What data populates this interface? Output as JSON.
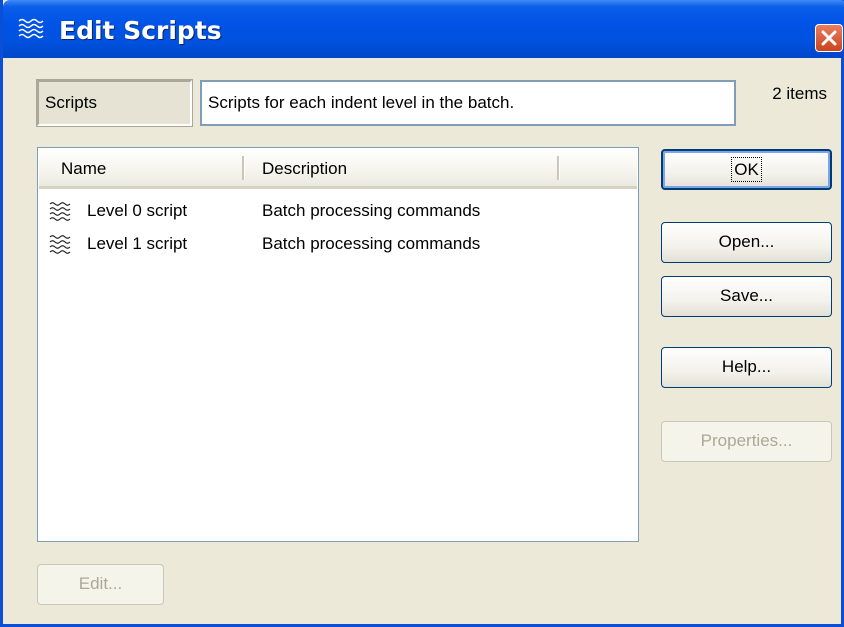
{
  "window": {
    "title": "Edit Scripts",
    "icon": "wavy-lines-icon",
    "close_icon": "close-icon"
  },
  "header": {
    "label": "Scripts",
    "description": "Scripts for each indent level in the batch.",
    "item_count": "2 items"
  },
  "list": {
    "columns": [
      "Name",
      "Description"
    ],
    "rows": [
      {
        "icon": "wavy-lines-icon",
        "name": "Level 0 script",
        "description": "Batch processing commands"
      },
      {
        "icon": "wavy-lines-icon",
        "name": "Level 1 script",
        "description": "Batch processing commands"
      }
    ]
  },
  "buttons": {
    "ok": "OK",
    "open": "Open...",
    "save": "Save...",
    "help": "Help...",
    "properties": "Properties...",
    "edit": "Edit..."
  },
  "colors": {
    "titlebar": "#0053e6",
    "dialog_bg": "#ece9d8",
    "close": "#c9441e"
  }
}
